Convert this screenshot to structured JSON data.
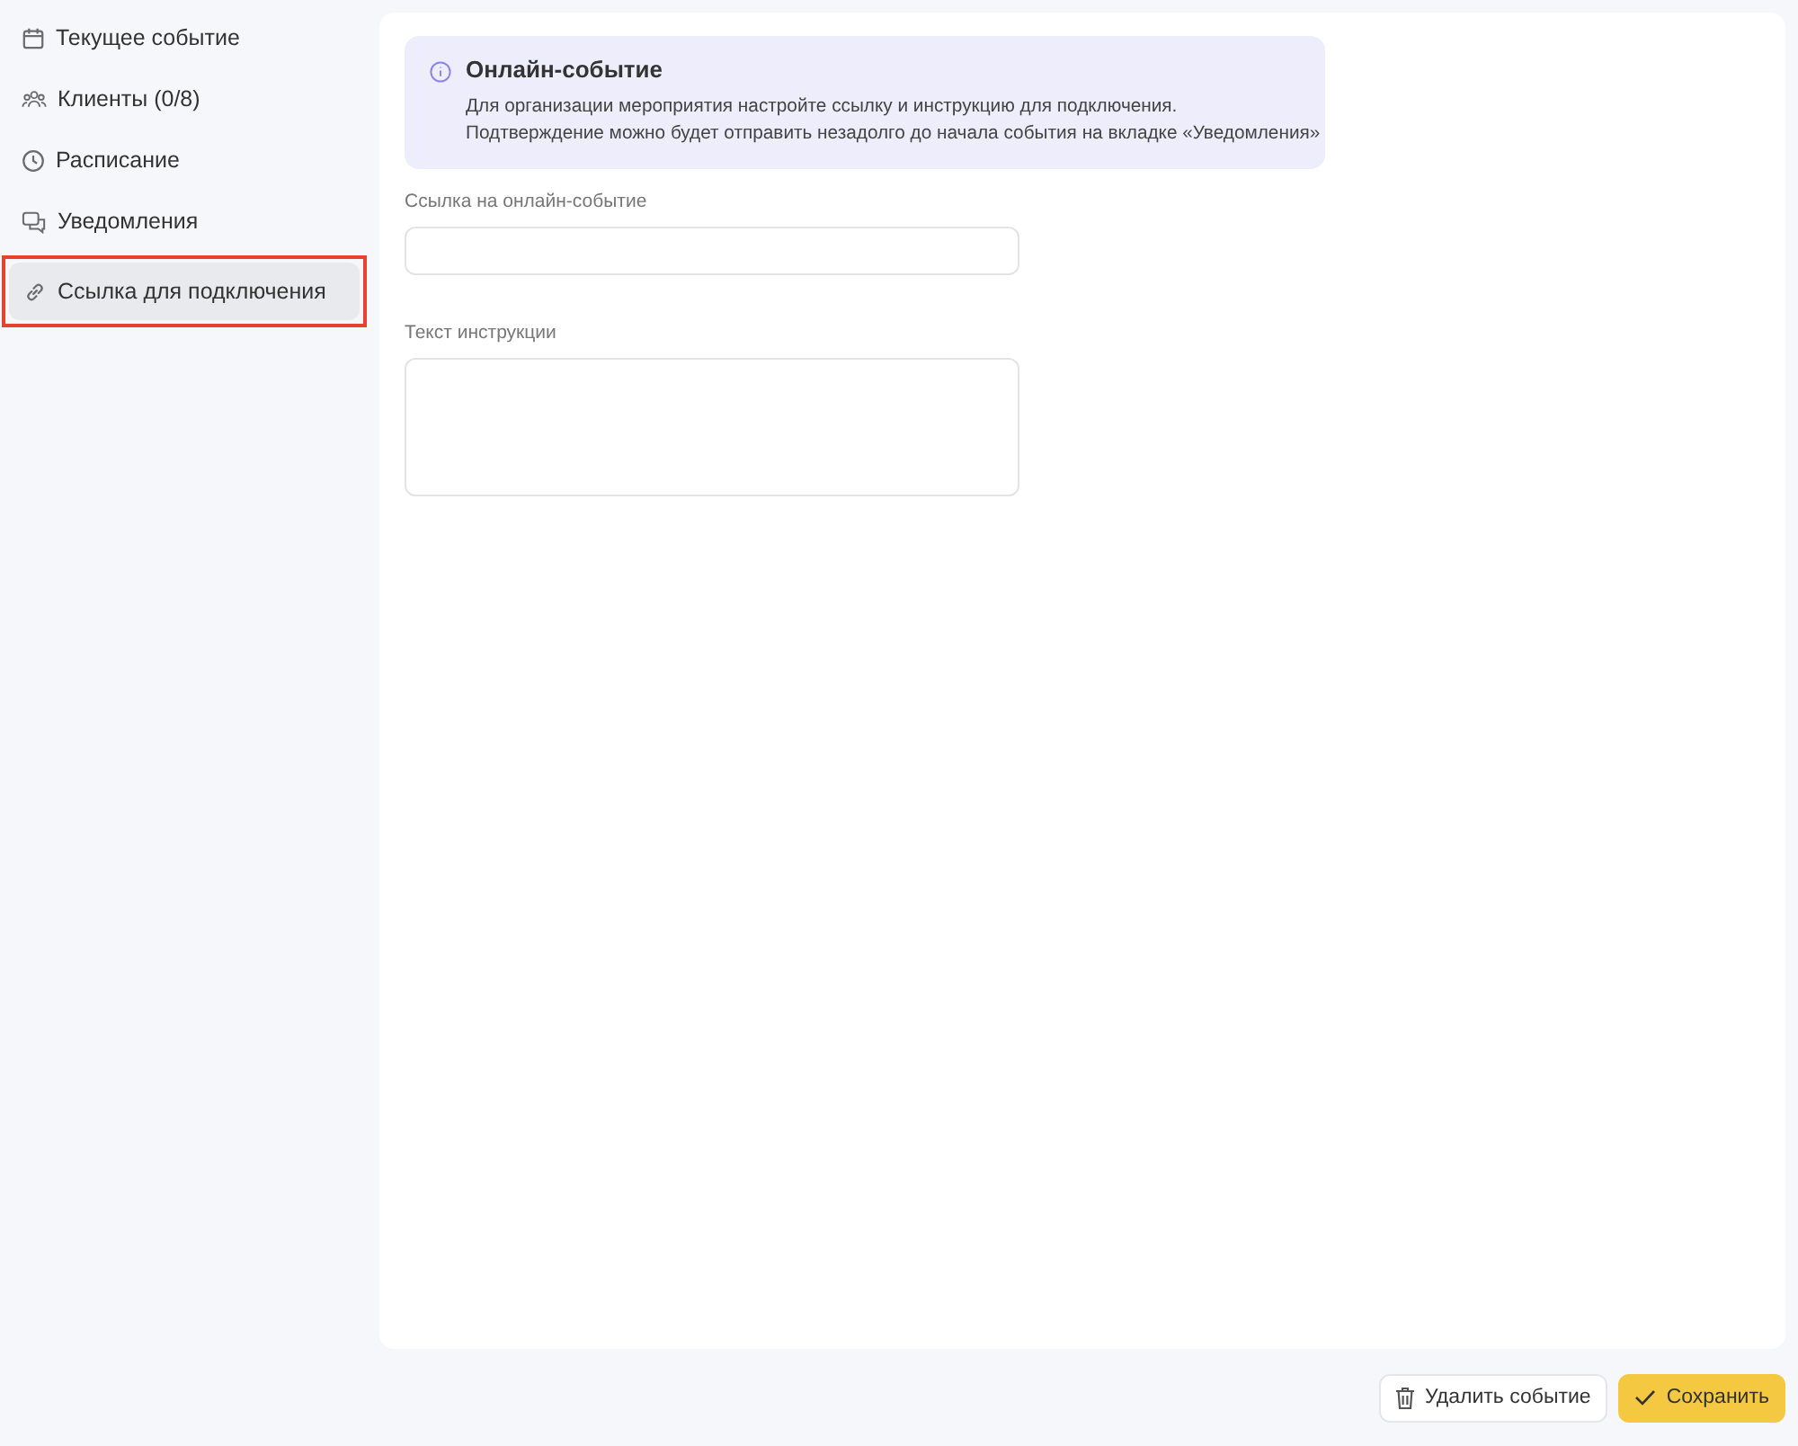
{
  "sidebar": {
    "items": [
      {
        "label": "Текущее событие",
        "kind": "calendar",
        "selected": false
      },
      {
        "label": "Клиенты (0/8)",
        "kind": "people",
        "selected": false
      },
      {
        "label": "Расписание",
        "kind": "clock",
        "selected": false
      },
      {
        "label": "Уведомления",
        "kind": "chat",
        "selected": false
      },
      {
        "label": "Ссылка для подключения",
        "kind": "link",
        "selected": true
      }
    ]
  },
  "notice": {
    "title": "Онлайн-событие",
    "lines": [
      "Для организации мероприятия настройте ссылку и инструкцию для подключения.",
      "Подтверждение можно будет отправить незадолго до начала события на вкладке «Уведомления»"
    ]
  },
  "fields": [
    {
      "label": "Ссылка на онлайн-событие",
      "kind": "input"
    },
    {
      "label": "Текст инструкции",
      "kind": "textarea"
    }
  ],
  "footer": {
    "delete_button": "Удалить событие",
    "save_button": "Сохранить"
  }
}
